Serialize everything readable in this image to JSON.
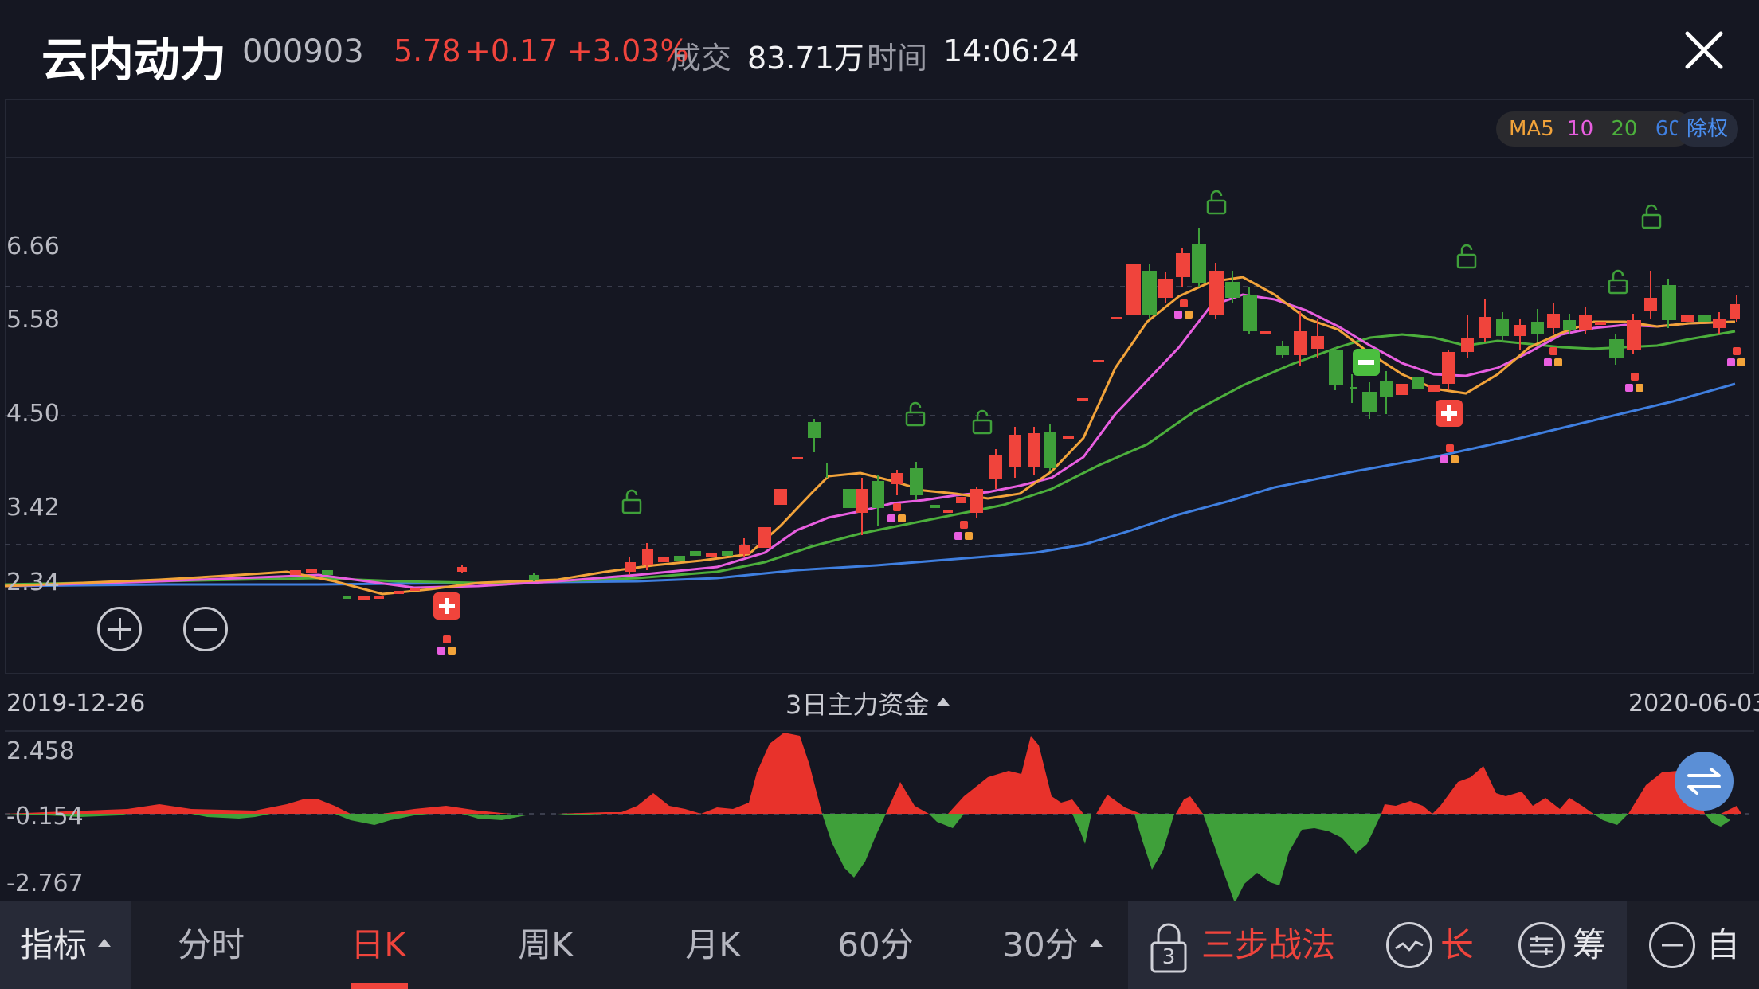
{
  "header": {
    "stock_name": "云内动力",
    "stock_code": "000903",
    "price": "5.78",
    "change": "+0.17",
    "change_pct": "+3.03%",
    "volume_label": "成交",
    "volume_value": "83.71万",
    "time_label": "时间",
    "time_value": "14:06:24"
  },
  "chart": {
    "y_labels": [
      "6.66",
      "5.58",
      "4.50",
      "3.42",
      "2.34"
    ],
    "ma_legend": {
      "ma5": "MA5",
      "ma10": "10",
      "ma20": "20",
      "ma60": "60"
    },
    "ex_rights": "除权",
    "start_date": "2019-12-26",
    "end_date": "2020-06-03",
    "indicator_title": "3日主力资金",
    "indicator_y_labels": [
      "2.458",
      "-0.154",
      "-2.767"
    ]
  },
  "colors": {
    "up": "#f0443c",
    "down": "#3fa03a",
    "ma5": "#f2a33a",
    "ma10": "#e85ee0",
    "ma20": "#4caf3c",
    "ma60": "#3f7fe0",
    "background": "#151722"
  },
  "icons": {
    "close": "close-icon",
    "zoom_in": "zoom-in-icon",
    "zoom_out": "zoom-out-icon",
    "lock": "lock-icon",
    "buy": "buy-signal-icon",
    "sell": "sell-signal-icon",
    "swap": "swap-icon"
  },
  "tabs": [
    {
      "label": "指标"
    },
    {
      "label": "分时"
    },
    {
      "label": "日K"
    },
    {
      "label": "周K"
    },
    {
      "label": "月K"
    },
    {
      "label": "60分"
    },
    {
      "label": "30分"
    }
  ],
  "toolbar": {
    "strategy_badge": "3",
    "strategy_label": "三步战法",
    "long_label": "长",
    "chip_label": "筹",
    "auto_label": "自"
  }
}
